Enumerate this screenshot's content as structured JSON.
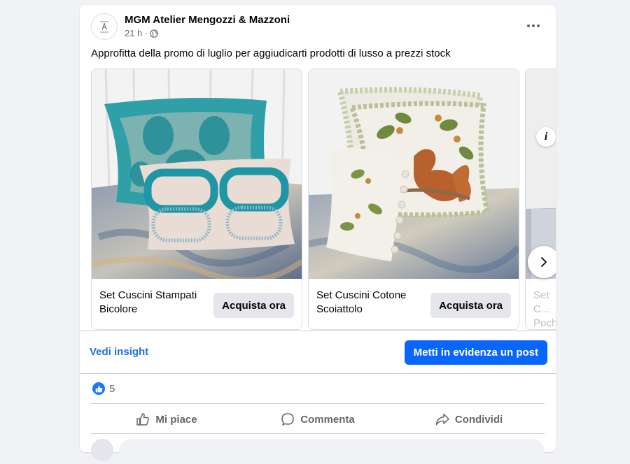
{
  "post": {
    "page_name": "MGM Atelier Mengozzi & Mazzoni",
    "time": "21 h",
    "text": "Approfitta della promo di luglio per aggiudicarti prodotti di lusso a prezzi stock"
  },
  "carousel": {
    "items": [
      {
        "title": "Set Cuscini Stampati Bicolore",
        "cta": "Acquista ora"
      },
      {
        "title": "Set Cuscini Cotone Scoiattolo",
        "cta": "Acquista ora"
      },
      {
        "title": "Set C... Poch..."
      }
    ],
    "info_glyph": "i"
  },
  "insights": {
    "link": "Vedi insight",
    "boost": "Metti in evidenza un post"
  },
  "reactions": {
    "count": "5"
  },
  "actions": {
    "like": "Mi piace",
    "comment": "Commenta",
    "share": "Condividi"
  },
  "colors": {
    "accent": "#0866ff",
    "link": "#216fdb",
    "like": "#1877f2"
  },
  "icons": [
    "globe-icon",
    "more-icon",
    "info-icon",
    "chevron-right-icon",
    "like-icon",
    "comment-icon",
    "share-icon"
  ]
}
